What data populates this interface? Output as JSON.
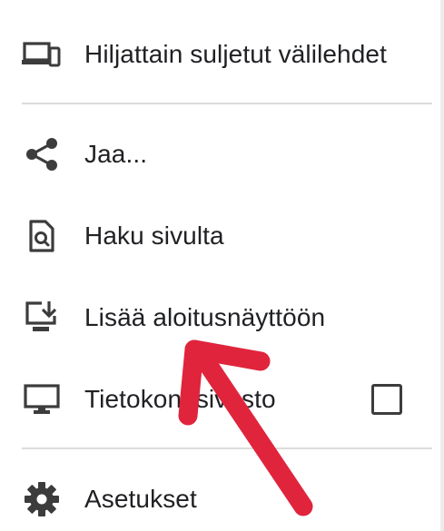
{
  "menu": {
    "items": [
      {
        "id": "recent-tabs",
        "label": "Hiljattain suljetut välilehdet",
        "icon": "devices-icon"
      },
      {
        "id": "share",
        "label": "Jaa...",
        "icon": "share-icon"
      },
      {
        "id": "find-in-page",
        "label": "Haku sivulta",
        "icon": "find-in-page-icon"
      },
      {
        "id": "add-to-home",
        "label": "Lisää aloitusnäyttöön",
        "icon": "add-to-home-screen-icon"
      },
      {
        "id": "desktop-site",
        "label": "Tietokonesivusto",
        "icon": "desktop-icon",
        "checked": false
      },
      {
        "id": "settings",
        "label": "Asetukset",
        "icon": "gear-icon"
      }
    ]
  },
  "annotation": {
    "arrow_color": "#e0243c",
    "points_to": "add-to-home"
  },
  "colors": {
    "text": "#202124",
    "icon": "#3c3c3c",
    "divider": "#dcdcdc",
    "background": "#ffffff"
  }
}
